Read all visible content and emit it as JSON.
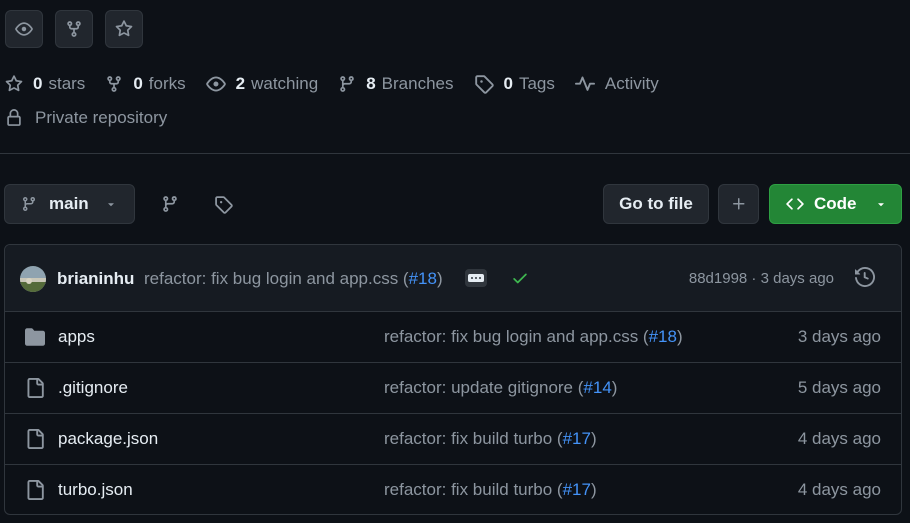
{
  "top_actions": [
    {
      "name": "watch-button",
      "icon": "eye-icon"
    },
    {
      "name": "fork-button",
      "icon": "repo-forked-icon"
    },
    {
      "name": "star-button",
      "icon": "star-icon"
    }
  ],
  "meta": {
    "stars": {
      "count": "0",
      "label": "stars"
    },
    "forks": {
      "count": "0",
      "label": "forks"
    },
    "watching": {
      "count": "2",
      "label": "watching"
    },
    "branches": {
      "count": "8",
      "label": "Branches"
    },
    "tags": {
      "count": "0",
      "label": "Tags"
    },
    "activity": {
      "label": "Activity"
    }
  },
  "visibility": "Private repository",
  "toolbar": {
    "branch": "main",
    "goto_file": "Go to file",
    "code": "Code"
  },
  "latest_commit": {
    "author": "brianinhu",
    "message": "refactor: fix bug login and app.css (",
    "pr": "#18",
    "message_end": ")",
    "hash": "88d1998",
    "separator": " · ",
    "time": "3 days ago"
  },
  "files": [
    {
      "type": "folder",
      "name": "apps",
      "message": "refactor: fix bug login and app.css (",
      "pr": "#18",
      "message_end": ")",
      "date": "3 days ago"
    },
    {
      "type": "file",
      "name": ".gitignore",
      "message": "refactor: update gitignore (",
      "pr": "#14",
      "message_end": ")",
      "date": "5 days ago"
    },
    {
      "type": "file",
      "name": "package.json",
      "message": "refactor: fix build turbo (",
      "pr": "#17",
      "message_end": ")",
      "date": "4 days ago"
    },
    {
      "type": "file",
      "name": "turbo.json",
      "message": "refactor: fix build turbo (",
      "pr": "#17",
      "message_end": ")",
      "date": "4 days ago"
    }
  ],
  "colors": {
    "background": "#0d1117",
    "border": "#30363d",
    "muted_text": "#8d96a0",
    "link": "#4493f8",
    "code_button": "#238636",
    "success": "#3fb950"
  }
}
